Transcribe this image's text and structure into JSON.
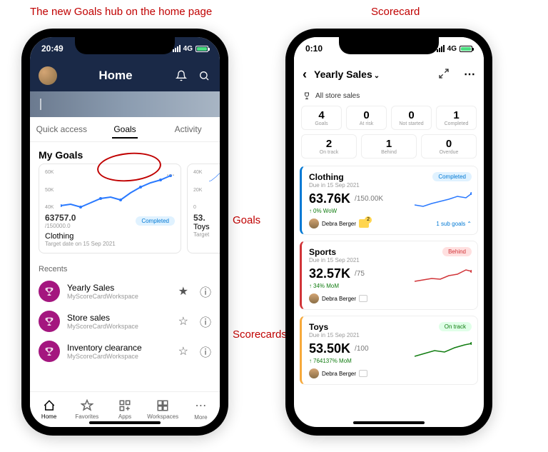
{
  "annotations": {
    "title_left": "The new Goals hub on the home page",
    "title_right": "Scorecard",
    "goals": "Goals",
    "scorecards": "Scorecards"
  },
  "phone1": {
    "status": {
      "time": "20:49",
      "net": "4G"
    },
    "header": {
      "title": "Home"
    },
    "tabs": [
      "Quick access",
      "Goals",
      "Activity"
    ],
    "section": "My Goals",
    "goal_cards": [
      {
        "ylabels": [
          "60K",
          "50K",
          "40K"
        ],
        "value": "63757.0",
        "target": "/150000.0",
        "badge": "Completed",
        "name": "Clothing",
        "note": "Target date on 15 Sep 2021"
      },
      {
        "ylabels": [
          "40K",
          "20K",
          "0"
        ],
        "value": "53.",
        "name": "Toys",
        "note": "Target"
      }
    ],
    "recents_title": "Recents",
    "recents": [
      {
        "name": "Yearly Sales",
        "ws": "MyScoreCardWorkspace",
        "starred": true
      },
      {
        "name": "Store sales",
        "ws": "MyScoreCardWorkspace",
        "starred": false
      },
      {
        "name": "Inventory clearance",
        "ws": "MyScoreCardWorkspace",
        "starred": false
      }
    ],
    "nav": [
      "Home",
      "Favorites",
      "Apps",
      "Workspaces",
      "More"
    ]
  },
  "phone2": {
    "status": {
      "time": "0:10",
      "net": "4G"
    },
    "header": {
      "title": "Yearly Sales"
    },
    "sub": "All store sales",
    "stats": [
      [
        {
          "n": "4",
          "l": "Goals"
        },
        {
          "n": "0",
          "l": "At risk"
        },
        {
          "n": "0",
          "l": "Not started"
        },
        {
          "n": "1",
          "l": "Completed"
        }
      ],
      [
        {
          "n": "2",
          "l": "On track"
        },
        {
          "n": "1",
          "l": "Behind"
        },
        {
          "n": "0",
          "l": "Overdue"
        }
      ]
    ],
    "cards": [
      {
        "color": "blue",
        "name": "Clothing",
        "due": "Due in 15 Sep 2021",
        "badge": "Completed",
        "badgeClass": "badge-completed",
        "val": "63.76K",
        "tgt": "/150.00K",
        "delta": "0% WoW",
        "owner": "Debra Berger",
        "hasNote": true,
        "sub": "1 sub goals"
      },
      {
        "color": "red",
        "name": "Sports",
        "due": "Due in 15 Sep 2021",
        "badge": "Behind",
        "badgeClass": "badge-behind",
        "val": "32.57K",
        "tgt": "/75",
        "delta": "34% MoM",
        "owner": "Debra Berger",
        "hasNote": false
      },
      {
        "color": "orange",
        "name": "Toys",
        "due": "Due in 15 Sep 2021",
        "badge": "On track",
        "badgeClass": "badge-ontrack",
        "val": "53.50K",
        "tgt": "/100",
        "delta": "764137% MoM",
        "owner": "Debra Berger",
        "hasNote": false
      }
    ]
  },
  "chart_data": [
    {
      "type": "line",
      "title": "Clothing goal trend",
      "ylim": [
        40000,
        60000
      ],
      "values": [
        41000,
        42000,
        40000,
        43000,
        46000,
        47000,
        45000,
        50000,
        55000,
        58000,
        60000,
        63000
      ]
    },
    {
      "type": "line",
      "title": "Toys goal trend",
      "ylim": [
        0,
        40000
      ],
      "values": [
        8000,
        10000,
        14000,
        20000,
        28000,
        35000,
        40000
      ]
    },
    {
      "type": "line",
      "title": "Clothing sparkline",
      "values": [
        40,
        42,
        38,
        45,
        50,
        55,
        60,
        63
      ]
    },
    {
      "type": "line",
      "title": "Sports sparkline",
      "values": [
        20,
        22,
        25,
        24,
        28,
        30,
        35,
        33
      ]
    },
    {
      "type": "line",
      "title": "Toys sparkline",
      "values": [
        10,
        15,
        25,
        30,
        40,
        48,
        53
      ]
    }
  ]
}
